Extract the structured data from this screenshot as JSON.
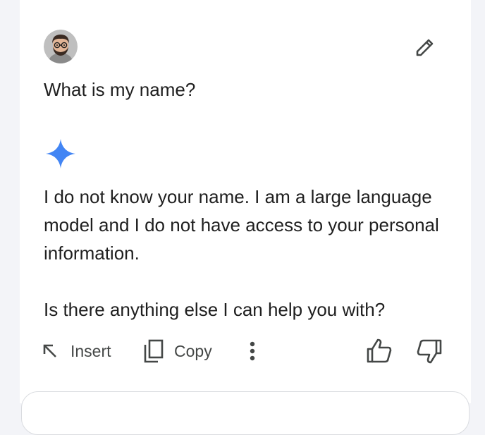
{
  "user": {
    "avatar": "user-avatar",
    "prompt": "What is my name?"
  },
  "icons": {
    "edit": "pencil-icon",
    "gemini": "gemini-sparkle-icon",
    "insert": "arrow-up-left-icon",
    "copy": "copy-icon",
    "more": "more-vert-icon",
    "thumbs_up": "thumbs-up-icon",
    "thumbs_down": "thumbs-down-icon"
  },
  "response": {
    "paragraphs": [
      "I do not know your name. I am a large language model and I do not have access to your personal information.",
      "Is there anything else I can help you with?"
    ]
  },
  "actions": {
    "insert_label": "Insert",
    "copy_label": "Copy"
  },
  "colors": {
    "gemini_blue": "#4285f4",
    "icon_gray": "#444746",
    "text": "#1f1f1f",
    "page_bg": "#f3f4f8",
    "panel_bg": "#ffffff"
  }
}
